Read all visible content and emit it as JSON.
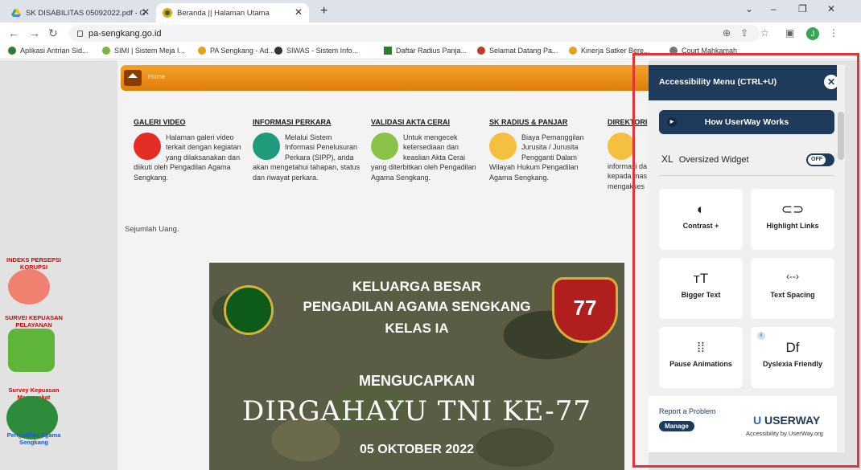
{
  "browser": {
    "tabs": [
      {
        "title": "SK DISABILITAS 05092022.pdf - G"
      },
      {
        "title": "Beranda || Halaman Utama"
      }
    ],
    "url": "pa-sengkang.go.id",
    "profile_initial": "J",
    "bookmarks": [
      "Aplikasi Antrian Sid...",
      "SIMI | Sistem Meja I...",
      "PA Sengkang - Ad...",
      "SIWAS - Sistem Info...",
      "Daftar Radius Panja...",
      "Selamat Datang Pa...",
      "Kinerja Satker Bere...",
      "Court Mahkamah"
    ]
  },
  "page": {
    "breadcrumb": "Home",
    "sections": [
      {
        "title": "GALERI VIDEO",
        "text": "Halaman galeri video terkait dengan kegiatan yang dilaksanakan dan diikuti oleh Pengadilan Agama Sengkang."
      },
      {
        "title": "INFORMASI PERKARA",
        "text": "Melalui Sistem Informasi Penelusuran Perkara (SIPP), anda akan mengetahui tahapan, status dan riwayat perkara."
      },
      {
        "title": "VALIDASI AKTA CERAI",
        "text": "Untuk mengecek ketersediaan dan keaslian Akta Cerai yang diterbitkan oleh Pengadilan Agama Sengkang."
      },
      {
        "title": "SK RADIUS & PANJAR",
        "text": "Biaya Pemanggilan Jurusita / Jurusita Pengganti Dalam Wilayah Hukum Pengadilan Agama Sengkang."
      },
      {
        "title": "DIREKTORI",
        "text": "informasi da kepada mas mengakses"
      }
    ],
    "sejumlah": "Sejumlah Uang.",
    "banner": {
      "line1": "KELUARGA BESAR",
      "line2": "PENGADILAN AGAMA SENGKANG",
      "line3": "KELAS IA",
      "line4": "MENGUCAPKAN",
      "line5": "DIRGAHAYU TNI KE-77",
      "line6": "05 OKTOBER 2022",
      "badge": "77"
    },
    "side": [
      {
        "label": "INDEKS PERSEPSI KORUPSI"
      },
      {
        "label": "SURVEI KEPUASAN PELAYANAN"
      },
      {
        "label": "Survey Kepuasan Masyarakat"
      },
      {
        "label": "Pengadilan Agama Sengkang"
      }
    ]
  },
  "accessibility": {
    "title": "Accessibility Menu (CTRL+U)",
    "how_button": "How UserWay Works",
    "xl_prefix": "XL",
    "oversized": "Oversized Widget",
    "toggle": "OFF",
    "cards": [
      {
        "label": "Contrast +",
        "icon": "◐"
      },
      {
        "label": "Highlight Links",
        "icon": "⊂⊃"
      },
      {
        "label": "Bigger Text",
        "icon": "тT"
      },
      {
        "label": "Text Spacing",
        "icon": "‹‐‐›"
      },
      {
        "label": "Pause Animations",
        "icon": "⁞⁞"
      },
      {
        "label": "Dyslexia Friendly",
        "icon": "Df",
        "badge": "i"
      }
    ],
    "report": "Report a Problem",
    "manage": "Manage",
    "brand": "USERWAY",
    "brand_sub": "Accessibility by UserWay.org"
  },
  "colors": {
    "accent": "#1e3b5c",
    "highlight": "#e2343a"
  }
}
